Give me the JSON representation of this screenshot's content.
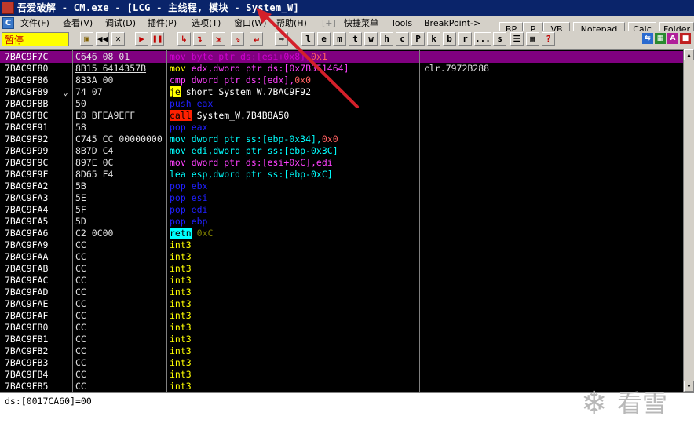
{
  "window": {
    "title": "吾爱破解 - CM.exe - [LCG - 主线程, 模块 - System_W]"
  },
  "menu": {
    "items": [
      "文件(F)",
      "查看(V)",
      "调试(D)",
      "插件(P)",
      "选项(T)",
      "窗口(W)",
      "帮助(H)",
      "[+]",
      "快捷菜单",
      "Tools",
      "BreakPoint->"
    ]
  },
  "toolbar_right": {
    "buttons": [
      "BP",
      "P",
      "VB",
      "Notepad",
      "Calc",
      "Folder"
    ]
  },
  "toolbar": {
    "status": "暂停",
    "letter_buttons": [
      "l",
      "e",
      "m",
      "t",
      "w",
      "h",
      "c",
      "P",
      "k",
      "b",
      "r",
      "...",
      "s"
    ]
  },
  "disasm": {
    "rows": [
      {
        "addr": "7BAC9F7C",
        "bytes": "C646 08 01",
        "mark": "",
        "instr": [
          {
            "t": "mov byte ptr ds:[esi+0x8],",
            "c": "#d000d0"
          },
          {
            "t": "0x1",
            "c": "#ff6060"
          }
        ],
        "cmt": ""
      },
      {
        "addr": "7BAC9F80",
        "bytes": "8B15 6414357B",
        "mark": "",
        "instr": [
          {
            "t": "mov ",
            "c": "#ffff00"
          },
          {
            "t": "edx,dword ptr ds:[0x7B351464]",
            "c": "#ff40ff"
          }
        ],
        "cmt": "clr.7972B288"
      },
      {
        "addr": "7BAC9F86",
        "bytes": "833A 00",
        "mark": "",
        "instr": [
          {
            "t": "cmp dword ptr ds:[edx],",
            "c": "#ff40ff"
          },
          {
            "t": "0x0",
            "c": "#ff6060"
          }
        ],
        "cmt": ""
      },
      {
        "addr": "7BAC9F89",
        "bytes": "74 07",
        "mark": "⌄",
        "instr": [
          {
            "t": "je",
            "c": "#000000",
            "bg": "#ffff00"
          },
          {
            "t": " short System_W.7BAC9F92",
            "c": "#ffffff"
          }
        ],
        "cmt": ""
      },
      {
        "addr": "7BAC9F8B",
        "bytes": "50",
        "mark": "",
        "instr": [
          {
            "t": "push eax",
            "c": "#2020ff"
          }
        ],
        "cmt": ""
      },
      {
        "addr": "7BAC9F8C",
        "bytes": "E8 BFEA9EFF",
        "mark": "",
        "instr": [
          {
            "t": "call",
            "c": "#000000",
            "bg": "#ff2000"
          },
          {
            "t": " System_W.7B4B8A50",
            "c": "#ffffff"
          }
        ],
        "cmt": ""
      },
      {
        "addr": "7BAC9F91",
        "bytes": "58",
        "mark": "",
        "instr": [
          {
            "t": "pop eax",
            "c": "#2020ff"
          }
        ],
        "cmt": ""
      },
      {
        "addr": "7BAC9F92",
        "bytes": "C745 CC 00000000",
        "mark": "",
        "instr": [
          {
            "t": "mov dword ptr ss:[ebp-0x34],",
            "c": "#00ffff"
          },
          {
            "t": "0x0",
            "c": "#ff6060"
          }
        ],
        "cmt": ""
      },
      {
        "addr": "7BAC9F99",
        "bytes": "8B7D C4",
        "mark": "",
        "instr": [
          {
            "t": "mov edi,dword ptr ss:[ebp-0x3C]",
            "c": "#00ffff"
          }
        ],
        "cmt": ""
      },
      {
        "addr": "7BAC9F9C",
        "bytes": "897E 0C",
        "mark": "",
        "instr": [
          {
            "t": "mov dword ptr ds:[esi+0xC],edi",
            "c": "#ff40ff"
          }
        ],
        "cmt": ""
      },
      {
        "addr": "7BAC9F9F",
        "bytes": "8D65 F4",
        "mark": "",
        "instr": [
          {
            "t": "lea esp,dword ptr ss:[ebp-0xC]",
            "c": "#00ffff"
          }
        ],
        "cmt": ""
      },
      {
        "addr": "7BAC9FA2",
        "bytes": "5B",
        "mark": "",
        "instr": [
          {
            "t": "pop ebx",
            "c": "#2020ff"
          }
        ],
        "cmt": ""
      },
      {
        "addr": "7BAC9FA3",
        "bytes": "5E",
        "mark": "",
        "instr": [
          {
            "t": "pop esi",
            "c": "#2020ff"
          }
        ],
        "cmt": ""
      },
      {
        "addr": "7BAC9FA4",
        "bytes": "5F",
        "mark": "",
        "instr": [
          {
            "t": "pop edi",
            "c": "#2020ff"
          }
        ],
        "cmt": ""
      },
      {
        "addr": "7BAC9FA5",
        "bytes": "5D",
        "mark": "",
        "instr": [
          {
            "t": "pop ebp",
            "c": "#2020ff"
          }
        ],
        "cmt": ""
      },
      {
        "addr": "7BAC9FA6",
        "bytes": "C2 0C00",
        "mark": "",
        "instr": [
          {
            "t": "retn",
            "c": "#000000",
            "bg": "#00ffff"
          },
          {
            "t": " 0xC",
            "c": "#808000"
          }
        ],
        "cmt": ""
      },
      {
        "addr": "7BAC9FA9",
        "bytes": "CC",
        "mark": "",
        "instr": [
          {
            "t": "int3",
            "c": "#ffff00"
          }
        ],
        "cmt": ""
      },
      {
        "addr": "7BAC9FAA",
        "bytes": "CC",
        "mark": "",
        "instr": [
          {
            "t": "int3",
            "c": "#ffff00"
          }
        ],
        "cmt": ""
      },
      {
        "addr": "7BAC9FAB",
        "bytes": "CC",
        "mark": "",
        "instr": [
          {
            "t": "int3",
            "c": "#ffff00"
          }
        ],
        "cmt": ""
      },
      {
        "addr": "7BAC9FAC",
        "bytes": "CC",
        "mark": "",
        "instr": [
          {
            "t": "int3",
            "c": "#ffff00"
          }
        ],
        "cmt": ""
      },
      {
        "addr": "7BAC9FAD",
        "bytes": "CC",
        "mark": "",
        "instr": [
          {
            "t": "int3",
            "c": "#ffff00"
          }
        ],
        "cmt": ""
      },
      {
        "addr": "7BAC9FAE",
        "bytes": "CC",
        "mark": "",
        "instr": [
          {
            "t": "int3",
            "c": "#ffff00"
          }
        ],
        "cmt": ""
      },
      {
        "addr": "7BAC9FAF",
        "bytes": "CC",
        "mark": "",
        "instr": [
          {
            "t": "int3",
            "c": "#ffff00"
          }
        ],
        "cmt": ""
      },
      {
        "addr": "7BAC9FB0",
        "bytes": "CC",
        "mark": "",
        "instr": [
          {
            "t": "int3",
            "c": "#ffff00"
          }
        ],
        "cmt": ""
      },
      {
        "addr": "7BAC9FB1",
        "bytes": "CC",
        "mark": "",
        "instr": [
          {
            "t": "int3",
            "c": "#ffff00"
          }
        ],
        "cmt": ""
      },
      {
        "addr": "7BAC9FB2",
        "bytes": "CC",
        "mark": "",
        "instr": [
          {
            "t": "int3",
            "c": "#ffff00"
          }
        ],
        "cmt": ""
      },
      {
        "addr": "7BAC9FB3",
        "bytes": "CC",
        "mark": "",
        "instr": [
          {
            "t": "int3",
            "c": "#ffff00"
          }
        ],
        "cmt": ""
      },
      {
        "addr": "7BAC9FB4",
        "bytes": "CC",
        "mark": "",
        "instr": [
          {
            "t": "int3",
            "c": "#ffff00"
          }
        ],
        "cmt": ""
      },
      {
        "addr": "7BAC9FB5",
        "bytes": "CC",
        "mark": "",
        "instr": [
          {
            "t": "int3",
            "c": "#ffff00"
          }
        ],
        "cmt": ""
      }
    ]
  },
  "info": {
    "text": "ds:[0017CA60]=00"
  },
  "watermark": {
    "icon": "snowflake-icon",
    "text": "看雪"
  },
  "annotation": {
    "color": "#d4202a"
  },
  "colors": {
    "selection": "#800080",
    "title_bar": "#0a246a",
    "pause_bg": "#ffff00"
  }
}
